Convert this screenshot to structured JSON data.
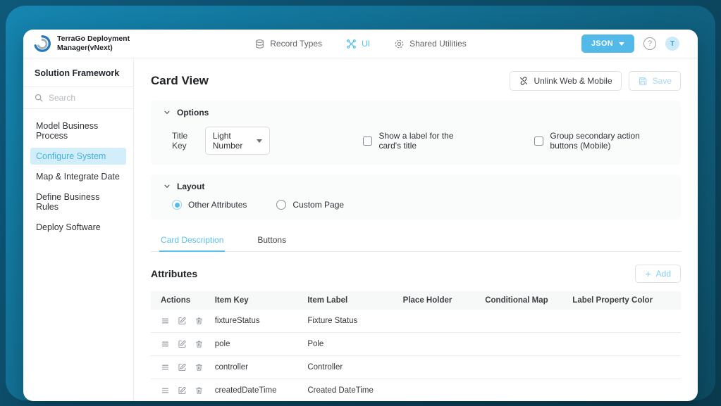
{
  "colors": {
    "accent": "#53bdea",
    "sidebar_selected_bg": "#d3eefb",
    "json_button_bg": "#53b9e8",
    "backdrop_light": "#1585b0",
    "backdrop_dark": "#0d4b63"
  },
  "header": {
    "brand_line1": "TerraGo Deployment",
    "brand_line2": "Manager(vNext)",
    "nav": [
      {
        "label": "Record Types",
        "icon": "database-icon",
        "active": false
      },
      {
        "label": "UI",
        "icon": "ui-icon",
        "active": true
      },
      {
        "label": "Shared Utilities",
        "icon": "gear-icon",
        "active": false
      }
    ],
    "json_button_label": "JSON",
    "help_glyph": "?",
    "avatar_initial": "T"
  },
  "sidebar": {
    "title": "Solution Framework",
    "search_placeholder": "Search",
    "items": [
      {
        "label": "Model Business Process",
        "active": false
      },
      {
        "label": "Configure System",
        "active": true
      },
      {
        "label": "Map & Integrate Date",
        "active": false
      },
      {
        "label": "Define Business Rules",
        "active": false
      },
      {
        "label": "Deploy Software",
        "active": false
      }
    ]
  },
  "main": {
    "title": "Card View",
    "unlink_button": "Unlink Web & Mobile",
    "save_button": "Save",
    "options": {
      "section_label": "Options",
      "title_key_label": "Title Key",
      "title_key_value": "Light Number",
      "checkboxes": [
        {
          "label": "Show a label for the card's title",
          "checked": false
        },
        {
          "label": "Group secondary action buttons (Mobile)",
          "checked": false
        }
      ]
    },
    "layout": {
      "section_label": "Layout",
      "radios": [
        {
          "label": "Other Attributes",
          "selected": true
        },
        {
          "label": "Custom Page",
          "selected": false
        }
      ]
    },
    "tabs": [
      {
        "label": "Card Description",
        "active": true
      },
      {
        "label": "Buttons",
        "active": false
      }
    ],
    "attributes": {
      "title": "Attributes",
      "add_label": "Add",
      "add_plus": "+",
      "columns": [
        "Actions",
        "Item Key",
        "Item Label",
        "Place Holder",
        "Conditional Map",
        "Label Property Color"
      ],
      "rows": [
        {
          "item_key": "fixtureStatus",
          "item_label": "Fixture Status",
          "place_holder": "",
          "conditional_map": "",
          "label_property_color": ""
        },
        {
          "item_key": "pole",
          "item_label": "Pole",
          "place_holder": "",
          "conditional_map": "",
          "label_property_color": ""
        },
        {
          "item_key": "controller",
          "item_label": "Controller",
          "place_holder": "",
          "conditional_map": "",
          "label_property_color": ""
        },
        {
          "item_key": "createdDateTime",
          "item_label": "Created DateTime",
          "place_holder": "",
          "conditional_map": "",
          "label_property_color": ""
        }
      ]
    }
  }
}
